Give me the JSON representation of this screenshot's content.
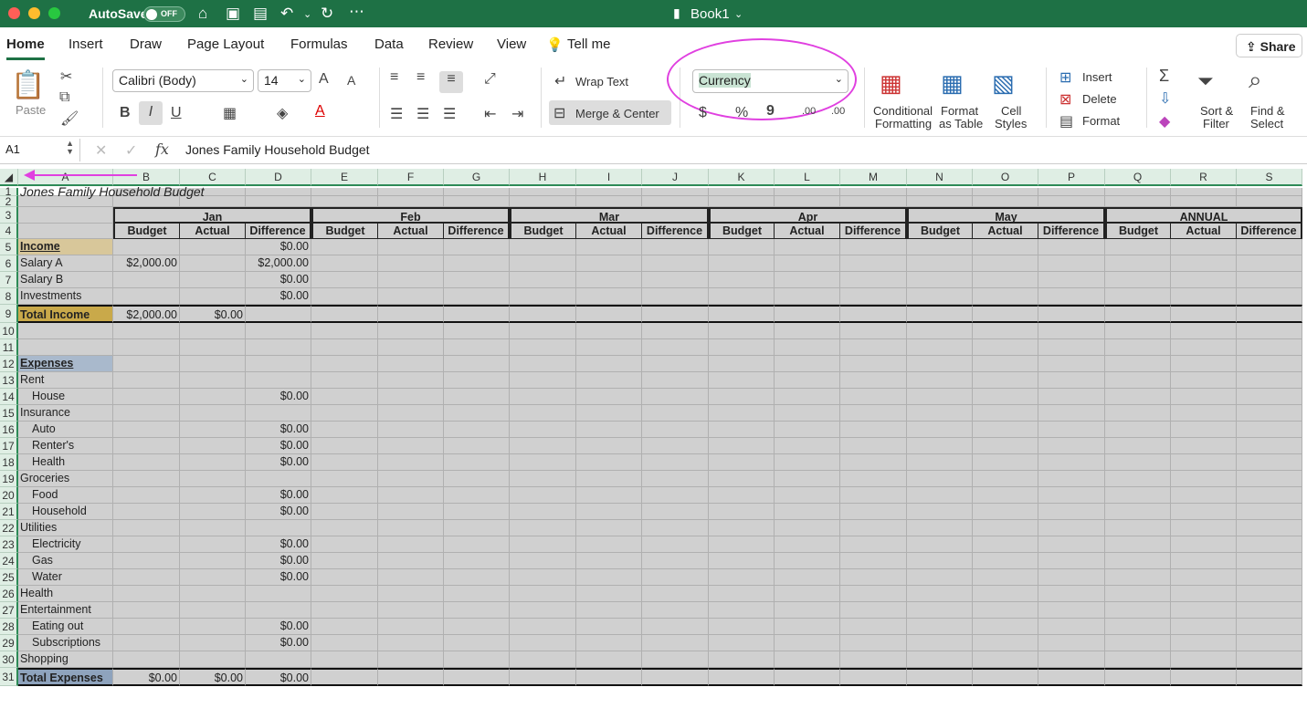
{
  "window": {
    "autosave_label": "AutoSave",
    "autosave_state": "OFF",
    "title": "Book1"
  },
  "tabs": [
    "Home",
    "Insert",
    "Draw",
    "Page Layout",
    "Formulas",
    "Data",
    "Review",
    "View"
  ],
  "tell_me": "Tell me",
  "share_label": "Share",
  "ribbon": {
    "paste": "Paste",
    "font_name": "Calibri (Body)",
    "font_size": "14",
    "wrap_text": "Wrap Text",
    "merge_center": "Merge & Center",
    "number_format": "Currency",
    "conditional": [
      "Conditional",
      "Formatting"
    ],
    "format_table": [
      "Format",
      "as Table"
    ],
    "cell_styles": [
      "Cell",
      "Styles"
    ],
    "insert": "Insert",
    "delete": "Delete",
    "format": "Format",
    "sort_filter": [
      "Sort &",
      "Filter"
    ],
    "find_select": [
      "Find &",
      "Select"
    ],
    "bold": "B",
    "italic": "I",
    "underline": "U",
    "dollar": "$",
    "percent": "%",
    "comma": "9",
    "inc_decimal": ".00",
    "dec_decimal": ".00",
    "grow_font": "A",
    "shrink_font": "A"
  },
  "formula_bar": {
    "name_box": "A1",
    "fx": "fx",
    "content": "Jones Family Household Budget"
  },
  "columns": [
    "A",
    "B",
    "C",
    "D",
    "E",
    "F",
    "G",
    "H",
    "I",
    "J",
    "K",
    "L",
    "M",
    "N",
    "O",
    "P",
    "Q",
    "R",
    "S"
  ],
  "months": [
    "Jan",
    "Feb",
    "Mar",
    "Apr",
    "May",
    "ANNUAL"
  ],
  "subheaders": [
    "Budget",
    "Actual",
    "Difference"
  ],
  "rows": [
    {
      "n": "1",
      "a": "Jones Family Household Budget"
    },
    {
      "n": "2"
    },
    {
      "n": "3"
    },
    {
      "n": "4"
    },
    {
      "n": "5",
      "a": "Income",
      "d": "$0.00"
    },
    {
      "n": "6",
      "a": "Salary A",
      "b": "$2,000.00",
      "d": "$2,000.00"
    },
    {
      "n": "7",
      "a": "Salary B",
      "d": "$0.00"
    },
    {
      "n": "8",
      "a": "Investments",
      "d": "$0.00"
    },
    {
      "n": "9",
      "a": "Total Income",
      "b": "$2,000.00",
      "c": "$0.00"
    },
    {
      "n": "10"
    },
    {
      "n": "11"
    },
    {
      "n": "12",
      "a": "Expenses"
    },
    {
      "n": "13",
      "a": "Rent"
    },
    {
      "n": "14",
      "a": "House",
      "d": "$0.00"
    },
    {
      "n": "15",
      "a": "Insurance"
    },
    {
      "n": "16",
      "a": "Auto",
      "d": "$0.00"
    },
    {
      "n": "17",
      "a": "Renter's",
      "d": "$0.00"
    },
    {
      "n": "18",
      "a": "Health",
      "d": "$0.00"
    },
    {
      "n": "19",
      "a": "Groceries"
    },
    {
      "n": "20",
      "a": "Food",
      "d": "$0.00"
    },
    {
      "n": "21",
      "a": "Household",
      "d": "$0.00"
    },
    {
      "n": "22",
      "a": "Utilities"
    },
    {
      "n": "23",
      "a": "Electricity",
      "d": "$0.00"
    },
    {
      "n": "24",
      "a": "Gas",
      "d": "$0.00"
    },
    {
      "n": "25",
      "a": "Water",
      "d": "$0.00"
    },
    {
      "n": "26",
      "a": "Health"
    },
    {
      "n": "27",
      "a": "Entertainment"
    },
    {
      "n": "28",
      "a": "Eating out",
      "d": "$0.00"
    },
    {
      "n": "29",
      "a": "Subscriptions",
      "d": "$0.00"
    },
    {
      "n": "30",
      "a": "Shopping"
    },
    {
      "n": "31",
      "a": "Total Expenses",
      "b": "$0.00",
      "c": "$0.00",
      "d": "$0.00"
    }
  ],
  "colors": {
    "excel_green": "#1e7145",
    "annotation_pink": "#e040e0",
    "income_fill": "#d8c79a",
    "total_income_fill": "#c9a94a",
    "expenses_fill": "#a9b9cc",
    "total_expenses_fill": "#8ea3bd"
  }
}
